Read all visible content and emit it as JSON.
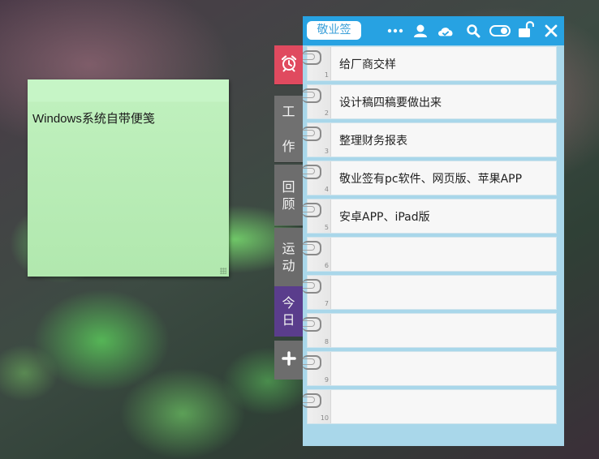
{
  "sticky_note": {
    "text": "Windows系统自带便笺"
  },
  "side_tabs": {
    "alarm_icon": "alarm-clock-icon",
    "work": [
      "工",
      "作"
    ],
    "review": [
      "回",
      "顾"
    ],
    "sport": [
      "运",
      "动"
    ],
    "today": [
      "今",
      "日"
    ],
    "add_icon": "plus-icon"
  },
  "panel": {
    "brand": "敬业签",
    "toolbar_icons": [
      "more-icon",
      "user-icon",
      "cloud-sync-icon",
      "search-icon",
      "toggle-icon",
      "unlock-icon",
      "close-icon"
    ],
    "rows": [
      {
        "num": "1",
        "text": "给厂商交样"
      },
      {
        "num": "2",
        "text": "设计稿四稿要做出来"
      },
      {
        "num": "3",
        "text": "整理财务报表"
      },
      {
        "num": "4",
        "text": "敬业签有pc软件、网页版、苹果APP"
      },
      {
        "num": "5",
        "text": "安卓APP、iPad版"
      },
      {
        "num": "6",
        "text": ""
      },
      {
        "num": "7",
        "text": ""
      },
      {
        "num": "8",
        "text": ""
      },
      {
        "num": "9",
        "text": ""
      },
      {
        "num": "10",
        "text": ""
      }
    ]
  },
  "colors": {
    "titlebar": "#27a2e2",
    "alarm_tab": "#e04a5f",
    "today_tab": "#5a3d8c",
    "sticky_bg": "#c6f5c6"
  }
}
